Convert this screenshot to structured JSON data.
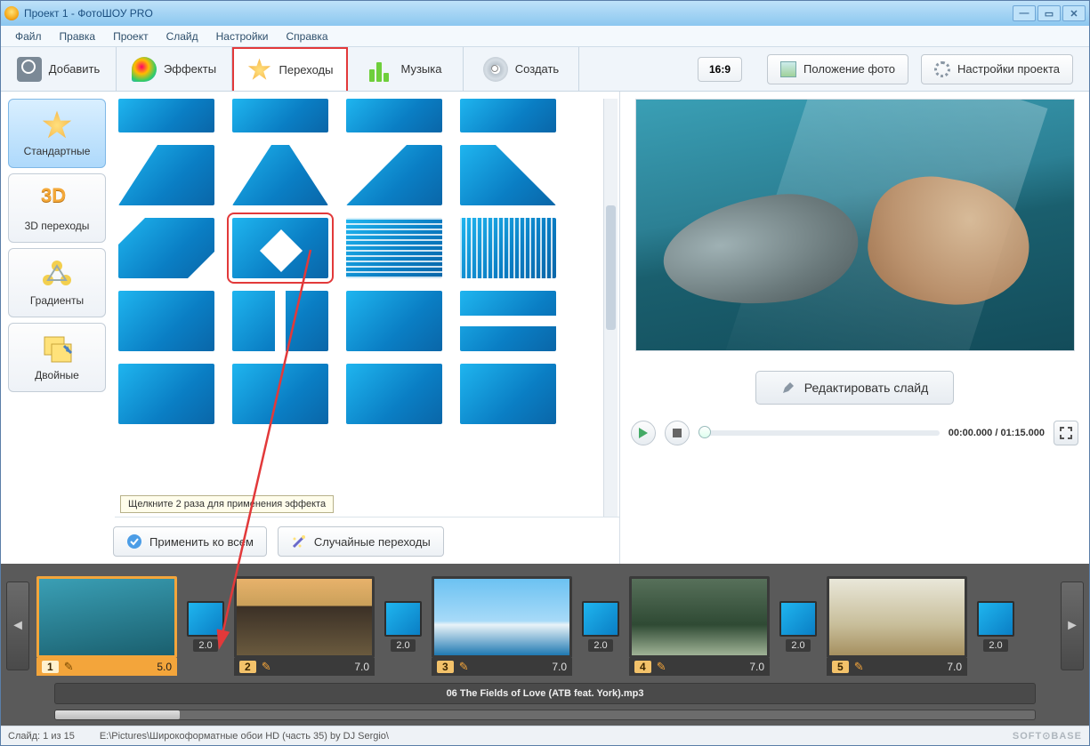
{
  "titlebar": {
    "title": "Проект 1 - ФотоШОУ PRO"
  },
  "menu": {
    "file": "Файл",
    "edit": "Правка",
    "project": "Проект",
    "slide": "Слайд",
    "settings": "Настройки",
    "help": "Справка"
  },
  "toolbar": {
    "add": "Добавить",
    "effects": "Эффекты",
    "transitions": "Переходы",
    "music": "Музыка",
    "create": "Создать"
  },
  "right_controls": {
    "aspect": "16:9",
    "photo_position": "Положение фото",
    "project_settings": "Настройки проекта"
  },
  "categories": {
    "standard": "Стандартные",
    "threeD_title": "3D",
    "threeD": "3D переходы",
    "gradients": "Градиенты",
    "doubles": "Двойные"
  },
  "tooltip": "Щелкните 2 раза для применения эффекта",
  "buttons": {
    "apply_all": "Применить ко всем",
    "random": "Случайные переходы",
    "edit_slide": "Редактировать слайд"
  },
  "playback": {
    "time": "00:00.000 / 01:15.000"
  },
  "timeline": {
    "audio_track": "06 The Fields of Love (ATB feat. York).mp3",
    "transition_duration": "2.0",
    "slides": [
      {
        "index": "1",
        "duration": "5.0"
      },
      {
        "index": "2",
        "duration": "7.0"
      },
      {
        "index": "3",
        "duration": "7.0"
      },
      {
        "index": "4",
        "duration": "7.0"
      },
      {
        "index": "5",
        "duration": "7.0"
      }
    ]
  },
  "status": {
    "slide_counter": "Слайд: 1 из 15",
    "path": "E:\\Pictures\\Широкоформатные обои HD (часть 35) by DJ Sergio\\",
    "brand": "SOFT⊙BASE"
  }
}
